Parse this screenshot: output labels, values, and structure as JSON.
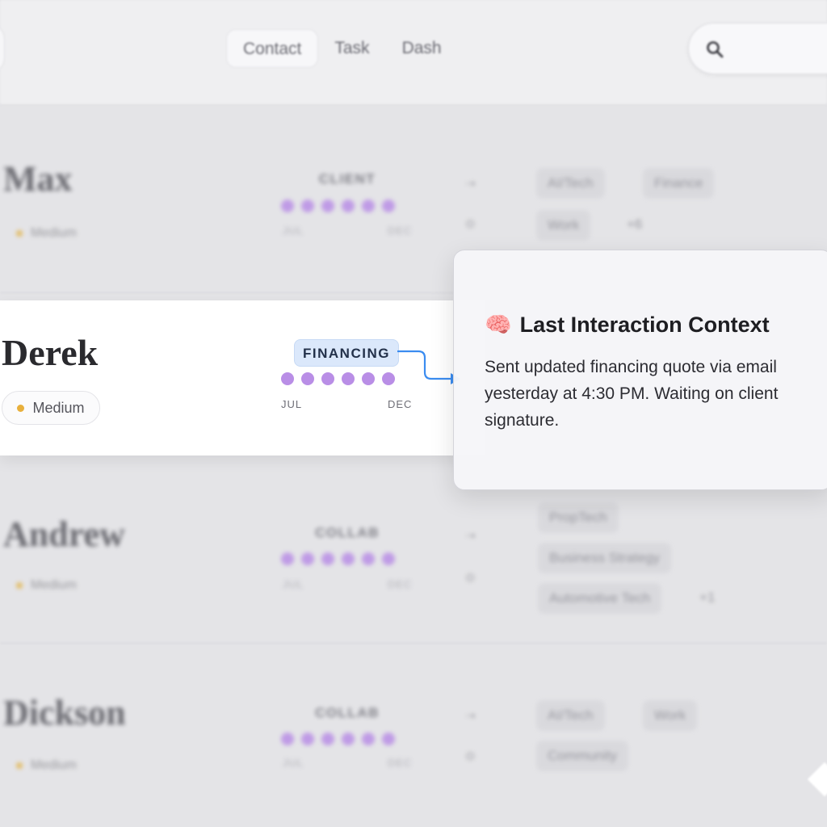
{
  "nav": {
    "tabs": [
      "Contact",
      "Task",
      "Dash"
    ],
    "active_tab": "Contact",
    "search_icon": "search-icon"
  },
  "rows": [
    {
      "name": "Max",
      "priority": "Medium",
      "stage": "CLIENT",
      "range_start": "JUL",
      "range_end": "DEC",
      "tags": [
        "AI/Tech",
        "Finance",
        "Work"
      ],
      "more": "+6"
    },
    {
      "name": "Derek",
      "priority": "Medium",
      "stage": "FINANCING",
      "range_start": "JUL",
      "range_end": "DEC"
    },
    {
      "name": "Andrew",
      "priority": "Medium",
      "stage": "COLLAB",
      "range_start": "JUL",
      "range_end": "DEC",
      "tags": [
        "PropTech",
        "Business Strategy",
        "Automotive Tech"
      ],
      "more": "+1"
    },
    {
      "name": "Dickson",
      "priority": "Medium",
      "stage": "COLLAB",
      "range_start": "JUL",
      "range_end": "DEC",
      "tags": [
        "AI/Tech",
        "Work",
        "Community"
      ]
    }
  ],
  "popover": {
    "icon": "brain-icon",
    "emoji": "🧠",
    "title": "Last Interaction Context",
    "body": "Sent updated financing quote via email yesterday at 4:30 PM. Waiting on client signature."
  },
  "colors": {
    "dot_purple": "#b98ee6",
    "priority_yellow": "#e8b03c",
    "stage_highlight": "#dbe8fb",
    "connector_blue": "#3b8cf0"
  }
}
